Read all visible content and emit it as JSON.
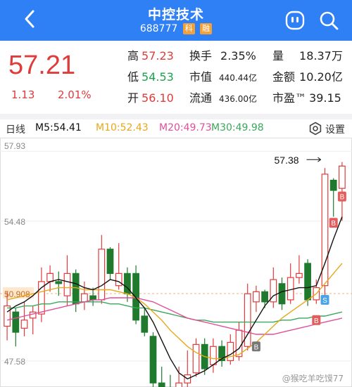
{
  "header": {
    "title": "中控技术",
    "code": "688777",
    "tags": [
      "科",
      "融"
    ],
    "bg": "#2f7ff5"
  },
  "quote": {
    "price": "57.21",
    "change": "1.13",
    "change_pct": "2.01%",
    "stats": {
      "high_label": "高",
      "high": "57.23",
      "low_label": "低",
      "low": "54.53",
      "open_label": "开",
      "open": "56.10",
      "turnover_label": "换手",
      "turnover": "2.35%",
      "mktcap_label": "市值",
      "mktcap": "440.44亿",
      "float_label": "流通",
      "float": "436.00亿",
      "volume_label": "量",
      "volume": "18.37万",
      "amount_label": "金额",
      "amount": "10.20亿",
      "pe_label": "市盈™",
      "pe": "39.15"
    },
    "up_color": "#e03b3b"
  },
  "ma_bar": {
    "period": "日线",
    "ma5": "M5:54.41",
    "ma10": "M10:52.43",
    "ma20": "M20:49.73",
    "ma30": "M30:49.98",
    "settings": "设置"
  },
  "chart_data": {
    "type": "candlestick",
    "y_ticks": [
      "57.93",
      "54.48",
      "50.908",
      "47.58"
    ],
    "ylim": [
      46.3,
      58.6
    ],
    "max_label": "57.38",
    "series_colors": {
      "ma5": "#111111",
      "ma10": "#e6a817",
      "ma20": "#e04f9a",
      "ma30": "#3aa85a",
      "up": "#e03b3b",
      "down": "#1f7a2e"
    },
    "candles": [
      {
        "o": 49.3,
        "c": 50.3,
        "h": 51.0,
        "l": 48.6
      },
      {
        "o": 50.0,
        "c": 49.0,
        "h": 50.2,
        "l": 48.3
      },
      {
        "o": 49.2,
        "c": 49.6,
        "h": 50.5,
        "l": 48.8
      },
      {
        "o": 49.7,
        "c": 50.0,
        "h": 50.3,
        "l": 48.9
      },
      {
        "o": 49.9,
        "c": 51.5,
        "h": 52.2,
        "l": 49.5
      },
      {
        "o": 51.5,
        "c": 51.9,
        "h": 52.3,
        "l": 51.0
      },
      {
        "o": 51.5,
        "c": 51.4,
        "h": 52.0,
        "l": 50.8
      },
      {
        "o": 50.8,
        "c": 51.9,
        "h": 52.8,
        "l": 50.3
      },
      {
        "o": 51.9,
        "c": 50.4,
        "h": 52.1,
        "l": 50.0
      },
      {
        "o": 50.5,
        "c": 50.9,
        "h": 51.5,
        "l": 50.1
      },
      {
        "o": 50.8,
        "c": 50.6,
        "h": 51.2,
        "l": 50.3
      },
      {
        "o": 50.6,
        "c": 53.1,
        "h": 53.8,
        "l": 50.4
      },
      {
        "o": 53.1,
        "c": 51.9,
        "h": 53.2,
        "l": 51.6
      },
      {
        "o": 51.3,
        "c": 51.9,
        "h": 53.4,
        "l": 51.1
      },
      {
        "o": 51.9,
        "c": 50.9,
        "h": 52.2,
        "l": 50.5
      },
      {
        "o": 51.9,
        "c": 49.6,
        "h": 52.3,
        "l": 49.4
      },
      {
        "o": 49.8,
        "c": 49.0,
        "h": 50.2,
        "l": 48.8
      },
      {
        "o": 48.8,
        "c": 46.5,
        "h": 49.0,
        "l": 46.3
      },
      {
        "o": 46.5,
        "c": 46.2,
        "h": 47.3,
        "l": 46.0
      },
      {
        "o": 46.2,
        "c": 46.1,
        "h": 46.9,
        "l": 45.9
      },
      {
        "o": 46.0,
        "c": 46.5,
        "h": 47.3,
        "l": 45.8
      },
      {
        "o": 46.5,
        "c": 46.9,
        "h": 48.1,
        "l": 46.3
      },
      {
        "o": 47.0,
        "c": 48.4,
        "h": 48.7,
        "l": 46.8
      },
      {
        "o": 48.4,
        "c": 47.2,
        "h": 48.7,
        "l": 46.9
      },
      {
        "o": 47.4,
        "c": 48.3,
        "h": 48.7,
        "l": 47.0
      },
      {
        "o": 48.3,
        "c": 47.6,
        "h": 48.6,
        "l": 47.3
      },
      {
        "o": 47.6,
        "c": 48.5,
        "h": 48.9,
        "l": 47.4
      },
      {
        "o": 47.8,
        "c": 49.1,
        "h": 49.5,
        "l": 47.6
      },
      {
        "o": 48.3,
        "c": 50.9,
        "h": 51.4,
        "l": 48.1
      },
      {
        "o": 50.5,
        "c": 51.0,
        "h": 51.3,
        "l": 50.0
      },
      {
        "o": 51.0,
        "c": 50.5,
        "h": 51.1,
        "l": 50.2
      },
      {
        "o": 50.5,
        "c": 51.6,
        "h": 52.2,
        "l": 50.2
      },
      {
        "o": 51.4,
        "c": 50.4,
        "h": 51.7,
        "l": 50.1
      },
      {
        "o": 50.6,
        "c": 51.7,
        "h": 52.4,
        "l": 50.4
      },
      {
        "o": 51.7,
        "c": 51.9,
        "h": 52.8,
        "l": 51.4
      },
      {
        "o": 52.4,
        "c": 50.6,
        "h": 52.6,
        "l": 50.3
      },
      {
        "o": 50.6,
        "c": 51.2,
        "h": 51.6,
        "l": 50.4
      },
      {
        "o": 51.3,
        "c": 56.8,
        "h": 57.1,
        "l": 50.6
      },
      {
        "o": 56.5,
        "c": 56.0,
        "h": 56.6,
        "l": 54.7
      },
      {
        "o": 56.1,
        "c": 57.2,
        "h": 57.4,
        "l": 54.5
      }
    ],
    "ma5": [
      50.0,
      50.3,
      50.5,
      50.8,
      51.2,
      51.5,
      51.6,
      51.5,
      51.4,
      51.2,
      51.1,
      51.3,
      51.6,
      51.5,
      51.2,
      50.7,
      50.2,
      49.5,
      48.6,
      47.7,
      47.0,
      46.7,
      46.9,
      47.1,
      47.4,
      47.7,
      47.9,
      48.2,
      48.9,
      49.6,
      50.3,
      50.8,
      51.0,
      51.1,
      51.2,
      51.2,
      51.3,
      52.4,
      53.6,
      54.7
    ],
    "ma10": [
      50.6,
      50.7,
      50.8,
      50.9,
      51.0,
      51.1,
      51.2,
      51.2,
      51.2,
      51.1,
      51.1,
      51.1,
      51.1,
      51.0,
      50.9,
      50.7,
      50.4,
      50.0,
      49.6,
      49.1,
      48.7,
      48.3,
      48.0,
      47.8,
      47.7,
      47.7,
      47.8,
      47.9,
      48.2,
      48.5,
      48.9,
      49.3,
      49.7,
      50.0,
      50.3,
      50.6,
      50.9,
      51.4,
      51.9,
      52.4
    ],
    "ma20": [
      49.6,
      49.7,
      49.8,
      49.9,
      50.0,
      50.1,
      50.2,
      50.3,
      50.4,
      50.5,
      50.6,
      50.6,
      50.7,
      50.7,
      50.7,
      50.7,
      50.6,
      50.5,
      50.3,
      50.1,
      49.9,
      49.7,
      49.6,
      49.5,
      49.4,
      49.3,
      49.2,
      49.1,
      49.0,
      48.9,
      48.9,
      48.9,
      49.0,
      49.1,
      49.2,
      49.3,
      49.4,
      49.5,
      49.6,
      49.7
    ],
    "ma30": [
      50.2,
      50.2,
      50.3,
      50.3,
      50.4,
      50.4,
      50.5,
      50.5,
      50.5,
      50.5,
      50.5,
      50.5,
      50.4,
      50.4,
      50.3,
      50.2,
      50.2,
      50.1,
      50.0,
      49.9,
      49.8,
      49.7,
      49.6,
      49.6,
      49.5,
      49.5,
      49.5,
      49.5,
      49.5,
      49.5,
      49.5,
      49.5,
      49.6,
      49.6,
      49.7,
      49.7,
      49.8,
      49.8,
      49.9,
      50.0
    ],
    "markers": [
      {
        "idx": 29,
        "label": "B",
        "price": 48.3
      },
      {
        "idx": 36,
        "label": "B",
        "price": 49.6
      },
      {
        "idx": 37,
        "label": "S",
        "price": 50.6
      },
      {
        "idx": 38,
        "label": "B",
        "price": 54.4
      },
      {
        "idx": 39,
        "label": "B",
        "price": 55.7
      }
    ]
  },
  "watermark": "@猴吃羊吃馍77"
}
